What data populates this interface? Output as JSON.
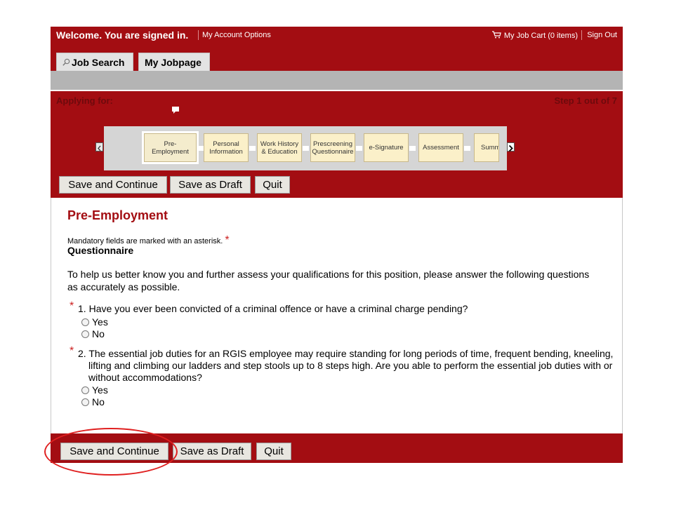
{
  "header": {
    "welcome": "Welcome. You are signed in.",
    "account_options": "My Account Options",
    "cart": "My Job Cart (0 items)",
    "sign_out": "Sign Out"
  },
  "tabs": [
    {
      "label": "Job Search",
      "icon": "search-icon"
    },
    {
      "label": "My Jobpage"
    }
  ],
  "progress": {
    "applying_for": "Applying for:",
    "step_info": "Step 1 out of 7",
    "steps": [
      {
        "label": "Pre-\nEmployment",
        "active": true
      },
      {
        "label": "Personal\nInformation"
      },
      {
        "label": "Work History\n& Education"
      },
      {
        "label": "Prescreening\nQuestionnaire"
      },
      {
        "label": "e-Signature"
      },
      {
        "label": "Assessment"
      },
      {
        "label": "Summ"
      }
    ]
  },
  "buttons": {
    "save_continue": "Save and Continue",
    "save_draft": "Save as Draft",
    "quit": "Quit"
  },
  "page": {
    "title": "Pre-Employment",
    "mandatory_note": "Mandatory fields are marked with an asterisk.",
    "asterisk": "*",
    "section": "Questionnaire",
    "intro": "To help us better know you and further assess your qualifications for this position, please answer the following questions as accurately as possible."
  },
  "questions": [
    {
      "number": "1.",
      "text": "Have you ever been convicted of a criminal offence or have a criminal charge pending?",
      "options": [
        "Yes",
        "No"
      ]
    },
    {
      "number": "2.",
      "text": "The essential job duties for an RGIS employee may require standing for long periods of time, frequent bending, kneeling, lifting and climbing our ladders and step stools up to 8 steps high. Are you able to perform the essential job duties with or without accommodations?",
      "options": [
        "Yes",
        "No"
      ]
    }
  ],
  "colors": {
    "brand_red": "#a30d12",
    "annotation_red": "#e02020"
  }
}
